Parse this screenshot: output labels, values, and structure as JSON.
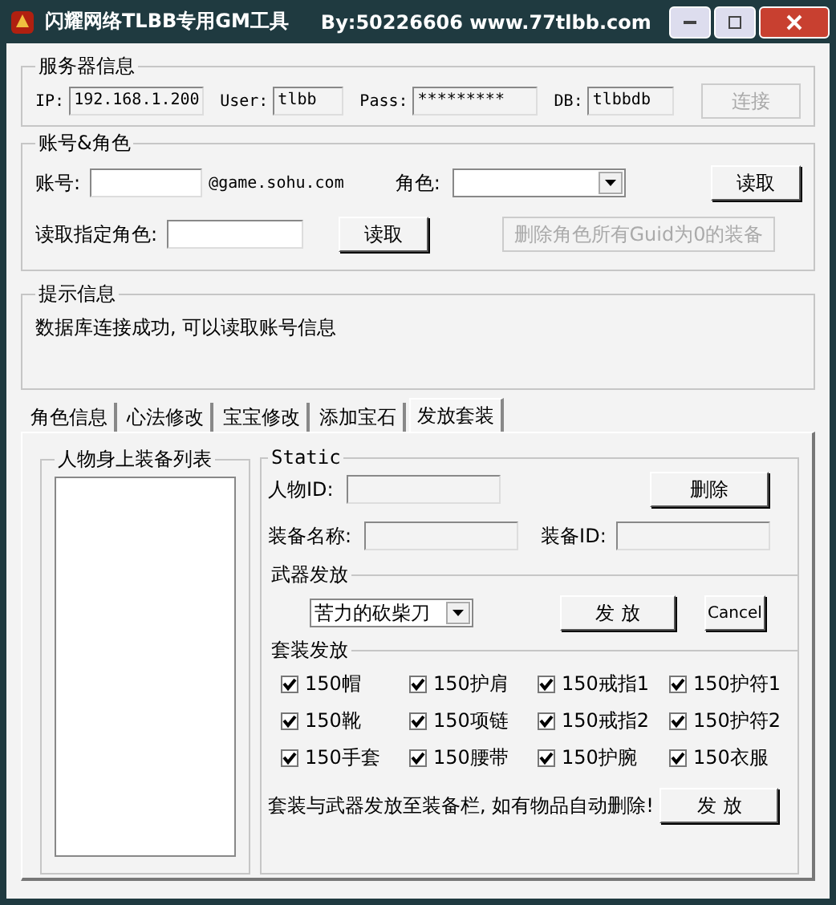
{
  "window": {
    "title": "闪耀网络TLBB专用GM工具",
    "subtitle": "By:50226606 www.77tlbb.com"
  },
  "server": {
    "title": "服务器信息",
    "fields": [
      {
        "label": "IP:",
        "value": "192.168.1.200"
      },
      {
        "label": "User:",
        "value": "tlbb"
      },
      {
        "label": "Pass:",
        "value": "*********"
      },
      {
        "label": "DB:",
        "value": "tlbbdb"
      }
    ],
    "connect_button": {
      "label": "连接",
      "disabled": true
    }
  },
  "account": {
    "title": "账号&角色",
    "account_label": "账号:",
    "account_suffix": "@game.sohu.com",
    "role_label": "角色:",
    "read_button": "读取",
    "specific_label": "读取指定角色:",
    "specific_read_button": "读取",
    "delete_button": {
      "label": "删除角色所有Guid为0的装备",
      "disabled": true
    }
  },
  "hint": {
    "title": "提示信息",
    "message": "数据库连接成功, 可以读取账号信息"
  },
  "tabs": [
    {
      "label": "角色信息",
      "selected": false
    },
    {
      "label": "心法修改",
      "selected": false
    },
    {
      "label": "宝宝修改",
      "selected": false
    },
    {
      "label": "添加宝石",
      "selected": false
    },
    {
      "label": "发放套装",
      "selected": true
    }
  ],
  "equipment_list": {
    "title": "人物身上装备列表"
  },
  "static": {
    "title": "Static",
    "char_id_label": "人物ID:",
    "delete_button": "删除",
    "equip_name_label": "装备名称:",
    "equip_id_label": "装备ID:"
  },
  "weapon": {
    "title": "武器发放",
    "dropdown_value": "苦力的砍柴刀",
    "issue_button": "发 放",
    "cancel_button": "Cancel"
  },
  "suit": {
    "title": "套装发放",
    "items": [
      {
        "label": "150帽",
        "checked": true
      },
      {
        "label": "150护肩",
        "checked": true
      },
      {
        "label": "150戒指1",
        "checked": true
      },
      {
        "label": "150护符1",
        "checked": true
      },
      {
        "label": "150靴",
        "checked": true
      },
      {
        "label": "150项链",
        "checked": true
      },
      {
        "label": "150戒指2",
        "checked": true
      },
      {
        "label": "150护符2",
        "checked": true
      },
      {
        "label": "150手套",
        "checked": true
      },
      {
        "label": "150腰带",
        "checked": true
      },
      {
        "label": "150护腕",
        "checked": true
      },
      {
        "label": "150衣服",
        "checked": true
      }
    ],
    "note": "套装与武器发放至装备栏, 如有物品自动删除!",
    "issue_button": "发 放"
  }
}
